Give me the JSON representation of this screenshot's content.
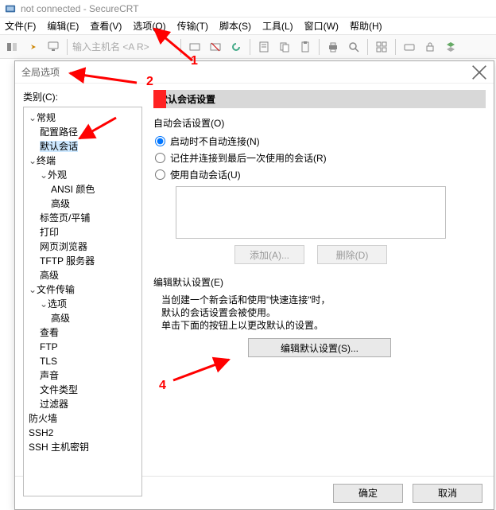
{
  "window": {
    "title": "not connected  -  SecureCRT"
  },
  "menubar": {
    "file": "文件(F)",
    "edit": "编辑(E)",
    "view": "查看(V)",
    "options": "选项(O)",
    "transfer": "传输(T)",
    "script": "脚本(S)",
    "tools": "工具(L)",
    "window": "窗口(W)",
    "help": "帮助(H)"
  },
  "toolbar": {
    "host_placeholder": "输入主机名 <A   R>"
  },
  "dialog": {
    "title": "全局选项",
    "categories_label": "类别(C):",
    "tree": {
      "general": "常规",
      "config_path": "配置路径",
      "default_session": "默认会话",
      "terminal": "终端",
      "appearance": "外观",
      "ansi_color": "ANSI 颜色",
      "advanced": "高级",
      "tabs": "标签页/平铺",
      "print": "打印",
      "web_browser": "网页浏览器",
      "tftp_server": "TFTP 服务器",
      "advanced2": "高级",
      "file_transfer": "文件传输",
      "options": "选项",
      "advanced3": "高级",
      "view": "查看",
      "ftp": "FTP",
      "tls": "TLS",
      "sound": "声音",
      "file_types": "文件类型",
      "filter": "过滤器",
      "firewall": "防火墙",
      "ssh2": "SSH2",
      "ssh_host_keys": "SSH 主机密钥"
    },
    "section_title": "默认会话设置",
    "auto_session_label": "自动会话设置(O)",
    "radio_no_auto": "启动时不自动连接(N)",
    "radio_remember": "记住并连接到最后一次使用的会话(R)",
    "radio_use_auto": "使用自动会话(U)",
    "btn_add": "添加(A)...",
    "btn_delete": "删除(D)",
    "edit_default_label": "编辑默认设置(E)",
    "desc_line1": "当创建一个新会话和使用\"快速连接\"时，",
    "desc_line2": "默认的会话设置会被使用。",
    "desc_line3": "单击下面的按钮上以更改默认的设置。",
    "btn_edit_default": "编辑默认设置(S)...",
    "btn_ok": "确定",
    "btn_cancel": "取消"
  },
  "annotations": {
    "n1": "1",
    "n2": "2",
    "n4": "4"
  }
}
